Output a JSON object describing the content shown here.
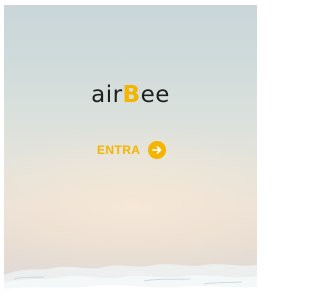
{
  "brand": {
    "logo_prefix": "air",
    "logo_accent": "B",
    "logo_suffix": "ee",
    "accent_color": "#f4b400",
    "text_color": "#1f1f1f"
  },
  "actions": {
    "enter_label": "ENTRA",
    "enter_icon": "arrow-right-circle-icon"
  }
}
